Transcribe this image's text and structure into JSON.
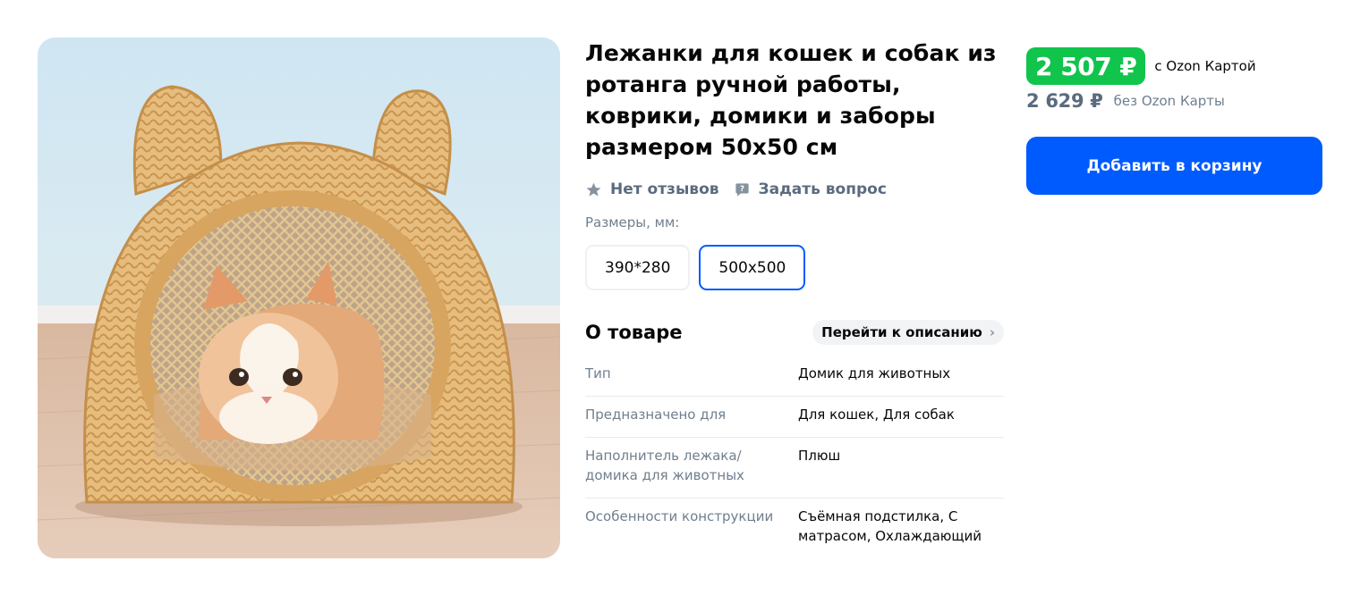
{
  "product": {
    "title": "Лежанки для кошек и собак из ротанга ручной работы, коврики, домики и заборы размером 50х50 см",
    "reviews_label": "Нет отзывов",
    "ask_question_label": "Задать вопрос",
    "sizes_label": "Размеры, мм:",
    "sizes": [
      {
        "label": "390*280",
        "selected": false
      },
      {
        "label": "500x500",
        "selected": true
      }
    ]
  },
  "about": {
    "title": "О товаре",
    "link_label": "Перейти к описанию",
    "specs": [
      {
        "key": "Тип",
        "value": "Домик для животных"
      },
      {
        "key": "Предназначено для",
        "value": "Для кошек, Для собак"
      },
      {
        "key": "Наполнитель лежака/ домика для животных",
        "value": "Плюш"
      },
      {
        "key": "Особенности конструкции",
        "value": "Съёмная подстилка, С матрасом, Охлаждающий"
      }
    ]
  },
  "price": {
    "card_price": "2 507 ₽",
    "card_note": "с Ozon Картой",
    "regular_price": "2 629 ₽",
    "regular_note": "без Ozon Карты"
  },
  "cart": {
    "add_label": "Добавить в корзину"
  },
  "colors": {
    "accent": "#005bff",
    "price_green": "#10c44c",
    "muted": "#707f8d"
  },
  "icons": [
    "star-icon",
    "chat-question-icon",
    "chevron-right-icon"
  ]
}
